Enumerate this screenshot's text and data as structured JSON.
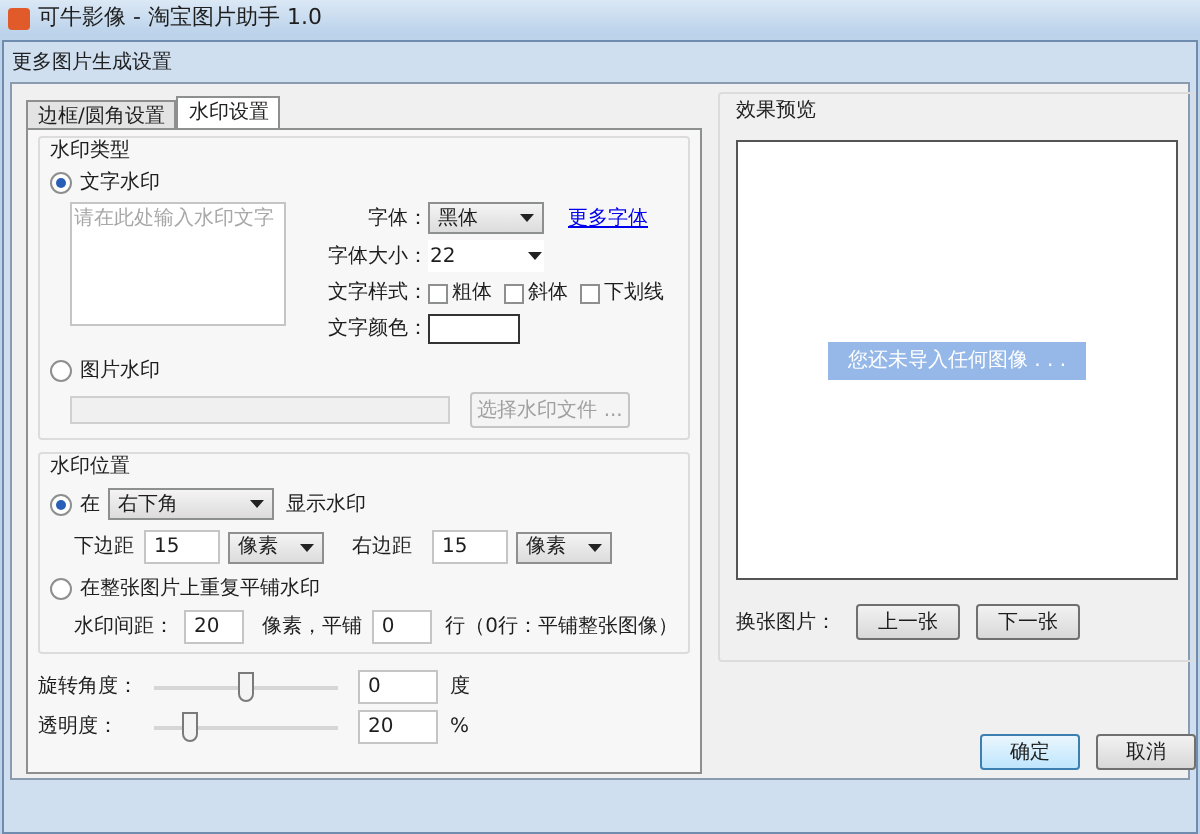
{
  "app_title": "可牛影像 - 淘宝图片助手 1.0",
  "dialog_title": "更多图片生成设置",
  "tabs": [
    {
      "label": "边框/圆角设置",
      "selected": false
    },
    {
      "label": "水印设置",
      "selected": true
    }
  ],
  "watermark_type": {
    "title": "水印类型",
    "text_option": {
      "label": "文字水印",
      "selected": true
    },
    "text_area": {
      "placeholder": "请在此处输入水印文字"
    },
    "font_label": "字体：",
    "font_value": "黑体",
    "more_fonts": "更多字体",
    "size_label": "字体大小：",
    "size_value": "22",
    "style_label": "文字样式：",
    "styles": [
      {
        "label": "粗体",
        "checked": false
      },
      {
        "label": "斜体",
        "checked": false
      },
      {
        "label": "下划线",
        "checked": false
      }
    ],
    "color_label": "文字颜色：",
    "color": "#ffffff",
    "image_option": {
      "label": "图片水印",
      "selected": false
    },
    "file_button": {
      "label": "选择水印文件 ...",
      "disabled": true
    }
  },
  "watermark_position": {
    "title": "水印位置",
    "corner_option": {
      "label": "在",
      "selected": true
    },
    "corner_value": "右下角",
    "show_label": "显示水印",
    "bottom_label": "下边距",
    "bottom_value": "15",
    "bottom_unit": "像素",
    "right_label": "右边距",
    "right_value": "15",
    "right_unit": "像素",
    "tile_option": {
      "label": "在整张图片上重复平铺水印",
      "selected": false
    },
    "spacing_label": "水印间距：",
    "spacing_value": "20",
    "spacing_unit": "像素，平铺",
    "rows_value": "0",
    "rows_note": "行（0行：平铺整张图像）"
  },
  "sliders": [
    {
      "label": "旋转角度：",
      "level": 0.5,
      "value": "0",
      "unit": "度"
    },
    {
      "label": "透明度：",
      "level": 0.2,
      "value": "20",
      "unit": "%"
    }
  ],
  "preview": {
    "title": "效果预览",
    "message": "您还未导入任何图像 . . .",
    "switch_label": "换张图片：",
    "prev": "上一张",
    "next": "下一张"
  },
  "buttons": [
    {
      "label": "确定",
      "default": true
    },
    {
      "label": "取消",
      "default": false
    }
  ]
}
